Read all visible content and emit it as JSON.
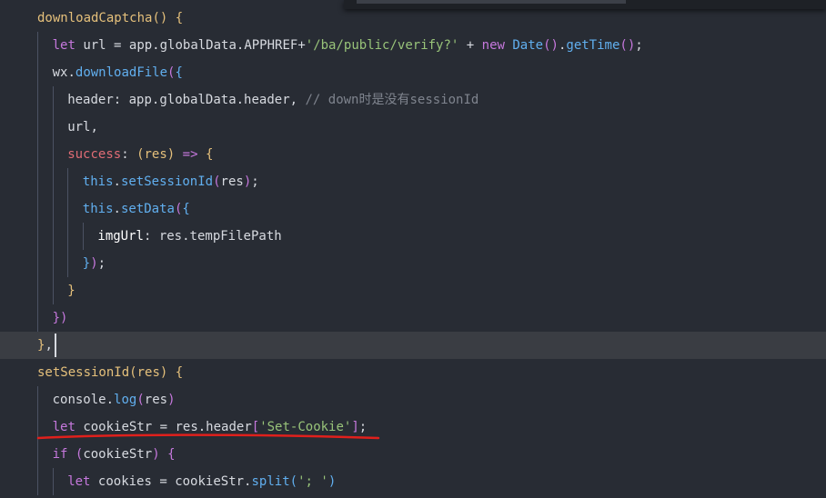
{
  "editor": {
    "lines": [
      {
        "tokens": [
          [
            "fnd",
            "downloadCaptcha"
          ],
          [
            "br1",
            "()"
          ],
          [
            "pun",
            " "
          ],
          [
            "br1",
            "{"
          ]
        ]
      },
      {
        "tokens": [
          [
            "kw2",
            "let"
          ],
          [
            "plain",
            " url = app.globalData.APPHREF+"
          ],
          [
            "str",
            "'/ba/public/verify?'"
          ],
          [
            "plain",
            " + "
          ],
          [
            "kw2",
            "new"
          ],
          [
            "plain",
            " "
          ],
          [
            "fn",
            "Date"
          ],
          [
            "br2",
            "()"
          ],
          [
            "plain",
            "."
          ],
          [
            "fn",
            "getTime"
          ],
          [
            "br2",
            "()"
          ],
          [
            "plain",
            ";"
          ]
        ]
      },
      {
        "tokens": [
          [
            "plain",
            "wx."
          ],
          [
            "fn",
            "downloadFile"
          ],
          [
            "br2",
            "("
          ],
          [
            "br3",
            "{"
          ]
        ]
      },
      {
        "tokens": [
          [
            "plain",
            "header: app.globalData.header, "
          ],
          [
            "cmt",
            "// down时是没有sessionId"
          ]
        ]
      },
      {
        "tokens": [
          [
            "plain",
            "url,"
          ]
        ]
      },
      {
        "tokens": [
          [
            "key",
            "success"
          ],
          [
            "plain",
            ": "
          ],
          [
            "br1",
            "("
          ],
          [
            "prm",
            "res"
          ],
          [
            "br1",
            ")"
          ],
          [
            "plain",
            " "
          ],
          [
            "kw2",
            "=>"
          ],
          [
            "plain",
            " "
          ],
          [
            "br1",
            "{"
          ]
        ]
      },
      {
        "tokens": [
          [
            "this",
            "this"
          ],
          [
            "plain",
            "."
          ],
          [
            "fn",
            "setSessionId"
          ],
          [
            "br2",
            "("
          ],
          [
            "plain",
            "res"
          ],
          [
            "br2",
            ")"
          ],
          [
            "plain",
            ";"
          ]
        ]
      },
      {
        "tokens": [
          [
            "this",
            "this"
          ],
          [
            "plain",
            "."
          ],
          [
            "fn",
            "setData"
          ],
          [
            "br2",
            "("
          ],
          [
            "br3",
            "{"
          ]
        ]
      },
      {
        "tokens": [
          [
            "bright",
            "imgUrl"
          ],
          [
            "plain",
            ": res.tempFilePath"
          ]
        ]
      },
      {
        "tokens": [
          [
            "br3",
            "}"
          ],
          [
            "br2",
            ")"
          ],
          [
            "plain",
            ";"
          ]
        ]
      },
      {
        "tokens": [
          [
            "br1",
            "}"
          ]
        ]
      },
      {
        "tokens": [
          [
            "br2",
            "})"
          ]
        ]
      },
      {
        "tokens": [
          [
            "br1",
            "}"
          ],
          [
            "plain",
            ","
          ]
        ]
      },
      {
        "tokens": [
          [
            "fnd",
            "setSessionId"
          ],
          [
            "br1",
            "("
          ],
          [
            "prm",
            "res"
          ],
          [
            "br1",
            ")"
          ],
          [
            "plain",
            " "
          ],
          [
            "br1",
            "{"
          ]
        ]
      },
      {
        "tokens": [
          [
            "plain",
            "console."
          ],
          [
            "fn",
            "log"
          ],
          [
            "br2",
            "("
          ],
          [
            "plain",
            "res"
          ],
          [
            "br2",
            ")"
          ]
        ]
      },
      {
        "tokens": [
          [
            "kw2",
            "let"
          ],
          [
            "plain",
            " cookieStr = res.header"
          ],
          [
            "br2",
            "["
          ],
          [
            "str",
            "'Set-Cookie'"
          ],
          [
            "br2",
            "]"
          ],
          [
            "plain",
            ";"
          ]
        ]
      },
      {
        "tokens": [
          [
            "kw2",
            "if"
          ],
          [
            "plain",
            " "
          ],
          [
            "br2",
            "("
          ],
          [
            "plain",
            "cookieStr"
          ],
          [
            "br2",
            ")"
          ],
          [
            "plain",
            " "
          ],
          [
            "br2",
            "{"
          ]
        ]
      },
      {
        "tokens": [
          [
            "kw2",
            "let"
          ],
          [
            "plain",
            " cookies = cookieStr."
          ],
          [
            "fn",
            "split"
          ],
          [
            "br3",
            "("
          ],
          [
            "str",
            "'; '"
          ],
          [
            "br3",
            ")"
          ]
        ]
      }
    ]
  },
  "colors": {
    "background": "#282c34",
    "current_line": "#3a3d43",
    "annotation_underline": "#e0201c"
  }
}
